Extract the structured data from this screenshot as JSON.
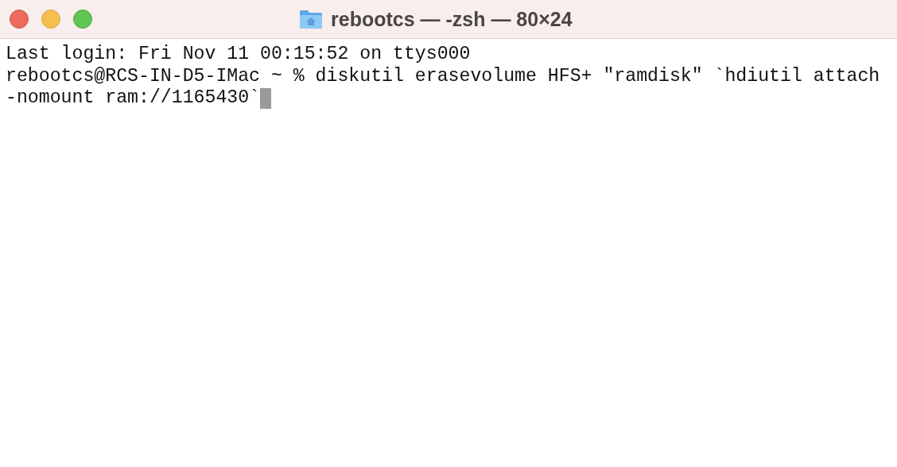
{
  "window": {
    "title": "rebootcs — -zsh — 80×24"
  },
  "terminal": {
    "lines": [
      "Last login: Fri Nov 11 00:15:52 on ttys000",
      "rebootcs@RCS-IN-D5-IMac ~ % diskutil erasevolume HFS+ \"ramdisk\" `hdiutil attach",
      "-nomount ram://1165430`"
    ],
    "cursor": true
  }
}
